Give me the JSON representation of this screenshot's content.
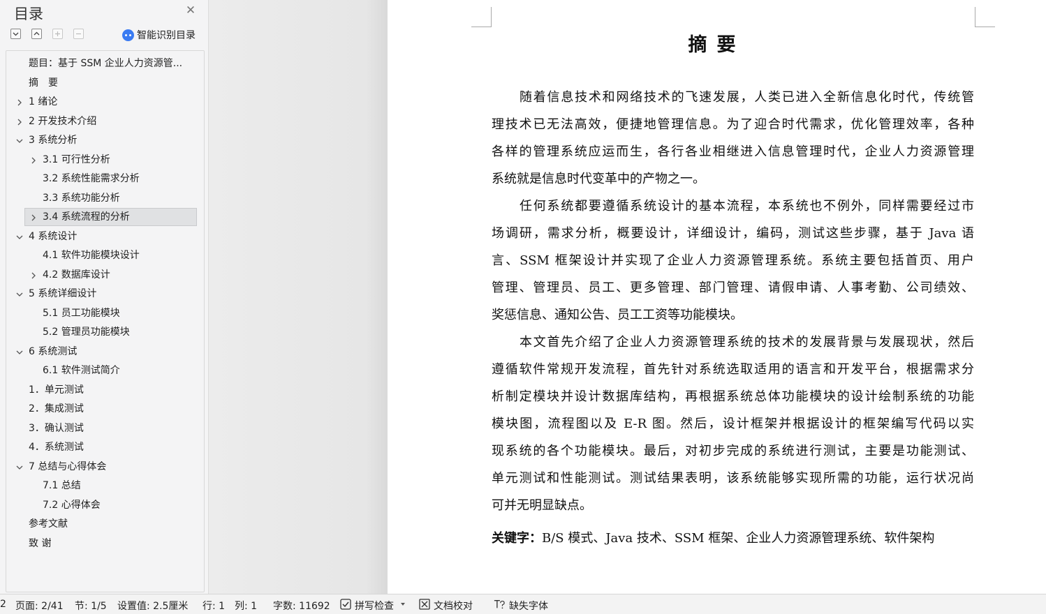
{
  "sidebar": {
    "title": "目录",
    "ai_toc_label": "智能识别目录",
    "items": [
      {
        "label": "题目：基于 SSM 企业人力资源管...",
        "level": 1,
        "chevron": "none"
      },
      {
        "label": "摘　要",
        "level": 1,
        "chevron": "none"
      },
      {
        "label": "1 绪论",
        "level": 1,
        "chevron": "right"
      },
      {
        "label": "2 开发技术介绍",
        "level": 1,
        "chevron": "right"
      },
      {
        "label": "3 系统分析",
        "level": 1,
        "chevron": "down"
      },
      {
        "label": "3.1 可行性分析",
        "level": 2,
        "chevron": "right"
      },
      {
        "label": "3.2 系统性能需求分析",
        "level": 2,
        "chevron": "none"
      },
      {
        "label": "3.3 系统功能分析",
        "level": 2,
        "chevron": "none"
      },
      {
        "label": "3.4 系统流程的分析",
        "level": 2,
        "chevron": "right",
        "selected": true
      },
      {
        "label": "4 系统设计",
        "level": 1,
        "chevron": "down"
      },
      {
        "label": "4.1  软件功能模块设计",
        "level": 2,
        "chevron": "none"
      },
      {
        "label": "4.2  数据库设计",
        "level": 2,
        "chevron": "right"
      },
      {
        "label": "5 系统详细设计",
        "level": 1,
        "chevron": "down"
      },
      {
        "label": "5.1 员工功能模块",
        "level": 2,
        "chevron": "none"
      },
      {
        "label": "5.2 管理员功能模块",
        "level": 2,
        "chevron": "none"
      },
      {
        "label": "6 系统测试",
        "level": 1,
        "chevron": "down"
      },
      {
        "label": "6.1  软件测试简介",
        "level": 2,
        "chevron": "none"
      },
      {
        "label": "1．单元测试",
        "level": 1,
        "chevron": "none"
      },
      {
        "label": "2．集成测试",
        "level": 1,
        "chevron": "none"
      },
      {
        "label": "3．确认测试",
        "level": 1,
        "chevron": "none"
      },
      {
        "label": "4．系统测试",
        "level": 1,
        "chevron": "none"
      },
      {
        "label": "7 总结与心得体会",
        "level": 1,
        "chevron": "down"
      },
      {
        "label": "7.1  总结",
        "level": 2,
        "chevron": "none"
      },
      {
        "label": "7.2  心得体会",
        "level": 2,
        "chevron": "none"
      },
      {
        "label": "参考文献",
        "level": 1,
        "chevron": "none"
      },
      {
        "label": "致  谢",
        "level": 1,
        "chevron": "none"
      }
    ]
  },
  "document": {
    "title": "摘要",
    "lines": [
      {
        "text": "随着信息技术和网络技术的飞速发展，人类已进入全新信息化时代，传统管",
        "indent": true,
        "last": false
      },
      {
        "text": "理技术已无法高效，便捷地管理信息。为了迎合时代需求，优化管理效率，各种",
        "indent": false,
        "last": false
      },
      {
        "text": "各样的管理系统应运而生，各行各业相继进入信息管理时代，企业人力资源管理",
        "indent": false,
        "last": false
      },
      {
        "text": "系统就是信息时代变革中的产物之一。",
        "indent": false,
        "last": true
      },
      {
        "text": "任何系统都要遵循系统设计的基本流程，本系统也不例外，同样需要经过市",
        "indent": true,
        "last": false
      },
      {
        "text": "场调研，需求分析，概要设计，详细设计，编码，测试这些步骤，基于 Java 语",
        "indent": false,
        "last": false
      },
      {
        "text": "言、SSM 框架设计并实现了企业人力资源管理系统。系统主要包括首页、用户",
        "indent": false,
        "last": false
      },
      {
        "text": "管理、管理员、员工、更多管理、部门管理、请假申请、人事考勤、公司绩效、",
        "indent": false,
        "last": false
      },
      {
        "text": "奖惩信息、通知公告、员工工资等功能模块。",
        "indent": false,
        "last": true
      },
      {
        "text": "本文首先介绍了企业人力资源管理系统的技术的发展背景与发展现状，然后",
        "indent": true,
        "last": false
      },
      {
        "text": "遵循软件常规开发流程，首先针对系统选取适用的语言和开发平台，根据需求分",
        "indent": false,
        "last": false
      },
      {
        "text": "析制定模块并设计数据库结构，再根据系统总体功能模块的设计绘制系统的功能",
        "indent": false,
        "last": false
      },
      {
        "text": "模块图，流程图以及 E-R 图。然后，设计框架并根据设计的框架编写代码以实",
        "indent": false,
        "last": false
      },
      {
        "text": "现系统的各个功能模块。最后，对初步完成的系统进行测试，主要是功能测试、",
        "indent": false,
        "last": false
      },
      {
        "text": "单元测试和性能测试。测试结果表明，该系统能够实现所需的功能，运行状况尚",
        "indent": false,
        "last": false
      },
      {
        "text": "可并无明显缺点。",
        "indent": false,
        "last": true
      }
    ],
    "keywords_label": "关键字：",
    "keywords_value": "B/S 模式、Java 技术、SSM 框架、企业人力资源管理系统、软件架构"
  },
  "statusbar": {
    "fragment": "2",
    "page": "页面: 2/41",
    "section": "节: 1/5",
    "setting": "设置值: 2.5厘米",
    "row": "行: 1",
    "col": "列: 1",
    "words": "字数: 11692",
    "spellcheck": "拼写检查",
    "proofread": "文档校对",
    "missing_font": "缺失字体"
  },
  "colors": {
    "selected_bg": "#e0e1e3",
    "accent": "#3a7bf2"
  }
}
